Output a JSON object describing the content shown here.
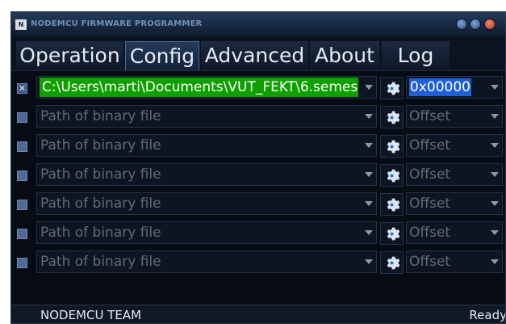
{
  "window": {
    "title": "NODEMCU FIRMWARE PROGRAMMER",
    "app_icon_glyph": "app-icon"
  },
  "tabs": [
    {
      "label": "Operation",
      "active": false
    },
    {
      "label": "Config",
      "active": true
    },
    {
      "label": "Advanced",
      "active": false
    },
    {
      "label": "About",
      "active": false
    },
    {
      "label": "Log",
      "active": false
    }
  ],
  "rows": [
    {
      "checked": true,
      "path": "C:\\Users\\marti\\Documents\\VUT_FEKT\\6.semes",
      "offset": "0x00000"
    },
    {
      "checked": false,
      "path": "Path of binary file",
      "offset": "Offset"
    },
    {
      "checked": false,
      "path": "Path of binary file",
      "offset": "Offset"
    },
    {
      "checked": false,
      "path": "Path of binary file",
      "offset": "Offset"
    },
    {
      "checked": false,
      "path": "Path of binary file",
      "offset": "Offset"
    },
    {
      "checked": false,
      "path": "Path of binary file",
      "offset": "Offset"
    },
    {
      "checked": false,
      "path": "Path of binary file",
      "offset": "Offset"
    }
  ],
  "status": {
    "team": "NODEMCU TEAM",
    "state": "Ready"
  },
  "colors": {
    "accent_green": "#0da000",
    "selection_blue": "#1f5fd6",
    "background": "#060b14"
  }
}
